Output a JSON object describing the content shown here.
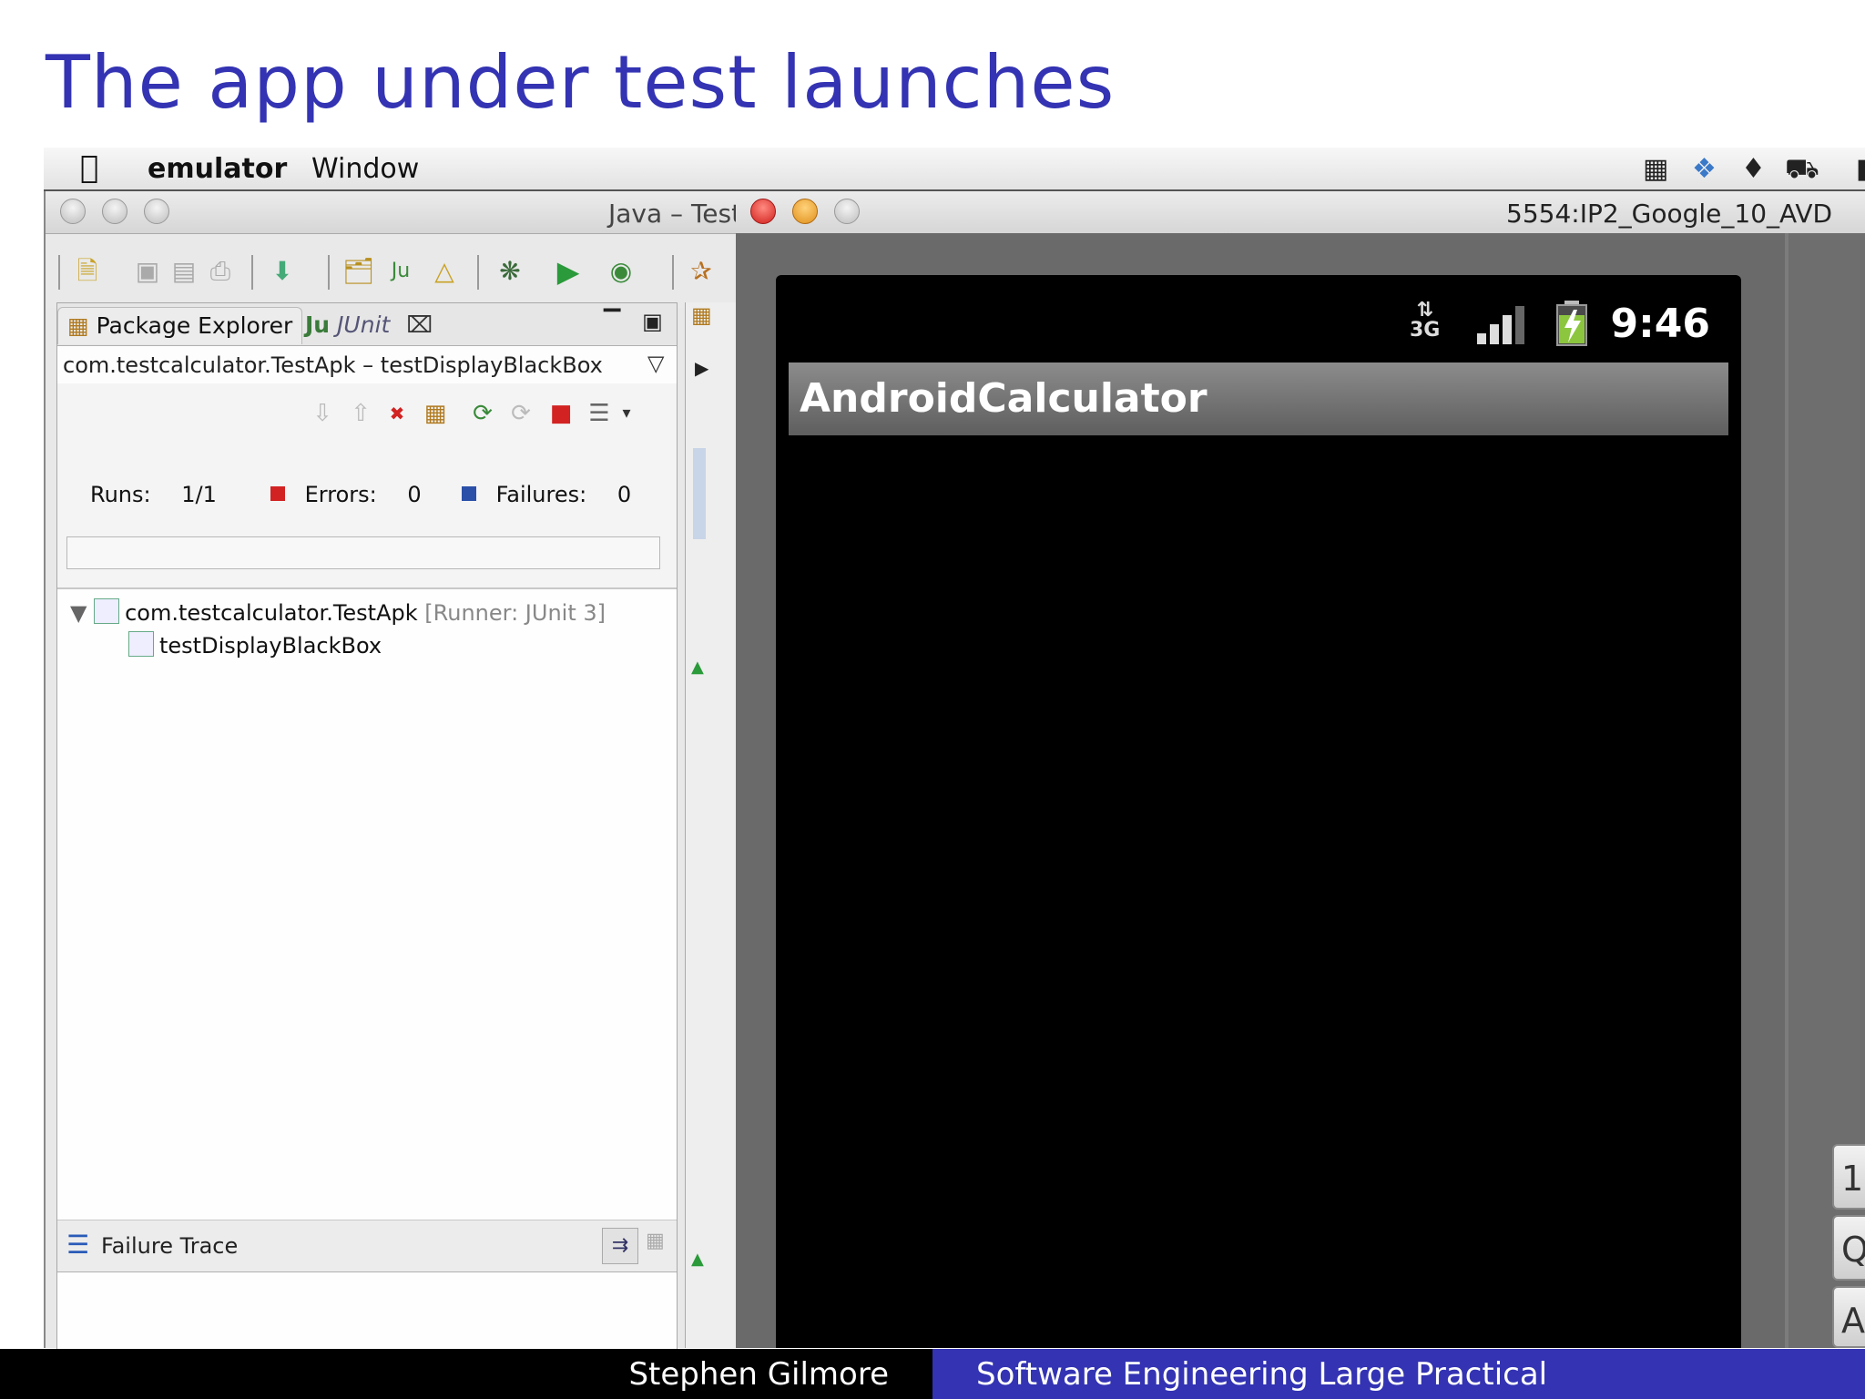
{
  "slide": {
    "title": "The app under test launches"
  },
  "menubar": {
    "app_name": "emulator",
    "items": [
      "Window"
    ]
  },
  "eclipse": {
    "window_title": "Java – Test",
    "tabs": {
      "package_explorer": "Package Explorer",
      "junit": "JUnit"
    },
    "summary": "com.testcalculator.TestApk – testDisplayBlackBox",
    "counters": {
      "runs_label": "Runs:",
      "runs_value": "1/1",
      "errors_label": "Errors:",
      "errors_value": "0",
      "failures_label": "Failures:",
      "failures_value": "0"
    },
    "progress_fraction": 0,
    "tree": {
      "suite_name": "com.testcalculator.TestApk",
      "suite_runner": "[Runner: JUnit 3]",
      "test_name": "testDisplayBlackBox"
    },
    "failure_trace_label": "Failure Trace"
  },
  "emulator": {
    "window_title": "5554:IP2_Google_10_AVD",
    "status": {
      "network": "3G",
      "time": "9:46"
    },
    "app_title": "AndroidCalculator",
    "keyboard_keys": [
      "1",
      "Q",
      "A"
    ]
  },
  "footer": {
    "author": "Stephen Gilmore",
    "course": "Software Engineering Large Practical"
  },
  "colors": {
    "title": "#3333b3",
    "footer_right": "#3333b3",
    "footer_left": "#000000",
    "error_red": "#d22222",
    "failure_blue": "#2a4fa8"
  }
}
